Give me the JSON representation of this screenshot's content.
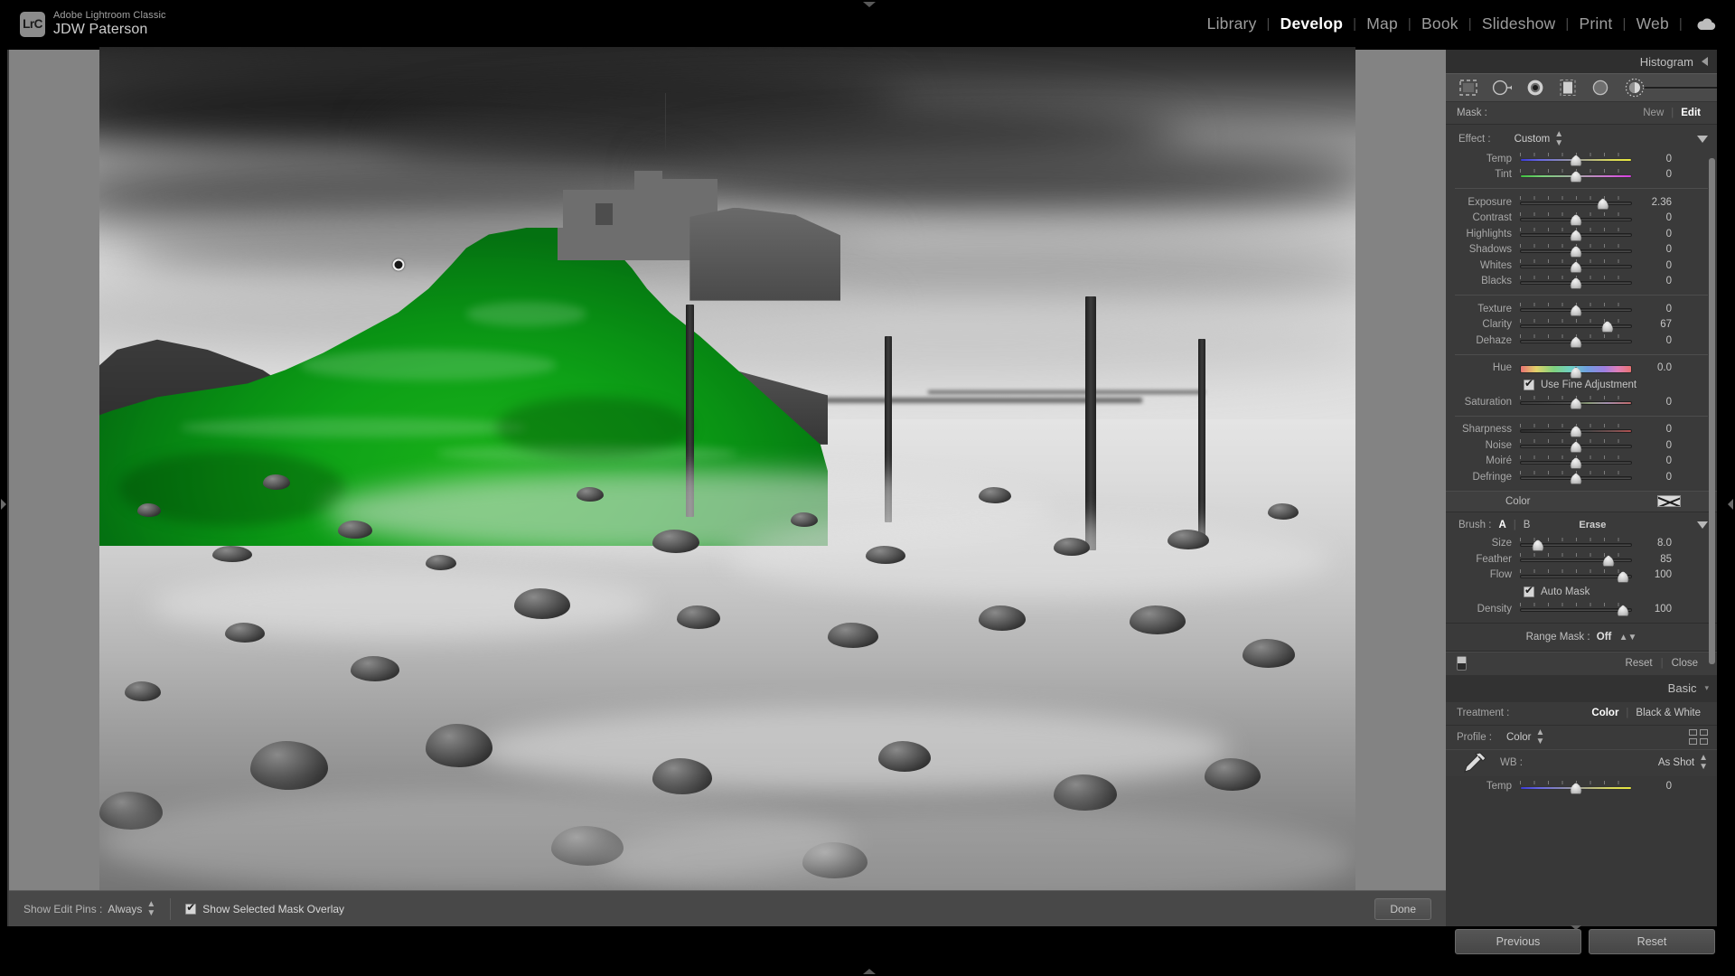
{
  "app": {
    "logo_text": "LrC",
    "product": "Adobe Lightroom Classic",
    "catalog": "JDW Paterson"
  },
  "modules": [
    {
      "label": "Library",
      "active": false
    },
    {
      "label": "Develop",
      "active": true
    },
    {
      "label": "Map",
      "active": false
    },
    {
      "label": "Book",
      "active": false
    },
    {
      "label": "Slideshow",
      "active": false
    },
    {
      "label": "Print",
      "active": false
    },
    {
      "label": "Web",
      "active": false
    }
  ],
  "cloud_icon": "cloud-sync-icon",
  "right_panel": {
    "histogram": {
      "title": "Histogram"
    },
    "tools": [
      {
        "name": "masking-icon",
        "selected": false
      },
      {
        "name": "linear-gradient-icon",
        "selected": false
      },
      {
        "name": "radial-gradient-icon",
        "selected": false
      },
      {
        "name": "crop-icon",
        "selected": false
      },
      {
        "name": "spot-removal-icon",
        "selected": false
      },
      {
        "name": "brush-icon",
        "selected": true
      }
    ],
    "mask": {
      "label": "Mask :",
      "new_label": "New",
      "edit_label": "Edit",
      "separator": "|"
    },
    "effect": {
      "label": "Effect :",
      "value": "Custom"
    },
    "sliders_wb": [
      {
        "name": "Temp",
        "value": "0",
        "pos": 50,
        "track": "temp"
      },
      {
        "name": "Tint",
        "value": "0",
        "pos": 50,
        "track": "tint"
      }
    ],
    "sliders_tone": [
      {
        "name": "Exposure",
        "value": "2.36",
        "pos": 74,
        "track": "plain"
      },
      {
        "name": "Contrast",
        "value": "0",
        "pos": 50,
        "track": "plain"
      },
      {
        "name": "Highlights",
        "value": "0",
        "pos": 50,
        "track": "plain"
      },
      {
        "name": "Shadows",
        "value": "0",
        "pos": 50,
        "track": "plain"
      },
      {
        "name": "Whites",
        "value": "0",
        "pos": 50,
        "track": "plain"
      },
      {
        "name": "Blacks",
        "value": "0",
        "pos": 50,
        "track": "plain"
      }
    ],
    "sliders_presence": [
      {
        "name": "Texture",
        "value": "0",
        "pos": 50,
        "track": "plain"
      },
      {
        "name": "Clarity",
        "value": "67",
        "pos": 78,
        "track": "plain"
      },
      {
        "name": "Dehaze",
        "value": "0",
        "pos": 50,
        "track": "plain"
      }
    ],
    "sliders_hue": [
      {
        "name": "Hue",
        "value": "0.0",
        "pos": 50,
        "track": "hue"
      }
    ],
    "fine_adjustment": {
      "label": "Use Fine Adjustment",
      "checked": true
    },
    "sliders_saturation": [
      {
        "name": "Saturation",
        "value": "0",
        "pos": 50,
        "track": "sat"
      }
    ],
    "sliders_detail": [
      {
        "name": "Sharpness",
        "value": "0",
        "pos": 50,
        "track": "sharp"
      },
      {
        "name": "Noise",
        "value": "0",
        "pos": 50,
        "track": "plain"
      },
      {
        "name": "Moiré",
        "value": "0",
        "pos": 50,
        "track": "plain"
      },
      {
        "name": "Defringe",
        "value": "0",
        "pos": 50,
        "track": "plain"
      }
    ],
    "color": {
      "label": "Color",
      "swatch": "no-color-swatch"
    },
    "brush": {
      "label": "Brush :",
      "a_label": "A",
      "b_label": "B",
      "erase_label": "Erase",
      "separator": "|",
      "sliders": [
        {
          "name": "Size",
          "value": "8.0",
          "pos": 16,
          "track": "plain"
        },
        {
          "name": "Feather",
          "value": "85",
          "pos": 79,
          "track": "plain"
        },
        {
          "name": "Flow",
          "value": "100",
          "pos": 92,
          "track": "plain"
        }
      ],
      "auto_mask": {
        "label": "Auto Mask",
        "checked": true
      },
      "density": {
        "name": "Density",
        "value": "100",
        "pos": 92,
        "track": "plain"
      }
    },
    "range_mask": {
      "label": "Range Mask :",
      "value": "Off"
    },
    "panel_footer": {
      "reset_label": "Reset",
      "close_label": "Close",
      "separator": "|",
      "switch": "panel-toggle-switch"
    },
    "basic": {
      "title": "Basic",
      "treatment_label": "Treatment :",
      "treatment_color": "Color",
      "treatment_bw": "Black & White",
      "separator": "|",
      "profile_label": "Profile :",
      "profile_value": "Color",
      "profile_browser": "profile-browser-icon",
      "wb_label": "WB :",
      "wb_value": "As Shot",
      "eyedropper": "white-balance-eyedropper-icon",
      "temp_label": "Temp",
      "temp_value": "0"
    }
  },
  "toolbar": {
    "show_edit_pins_label": "Show Edit Pins :",
    "show_edit_pins_value": "Always",
    "mask_overlay_label": "Show Selected Mask Overlay",
    "mask_overlay_checked": true,
    "done_label": "Done"
  },
  "bottom": {
    "previous_label": "Previous",
    "reset_label": "Reset"
  },
  "photo": {
    "description": "Lindisfarne Castle black and white long-exposure seascape with green mask overlay on the castle hill",
    "mask_overlay_color": "#28a028",
    "edit_pin": "brush-edit-pin"
  }
}
